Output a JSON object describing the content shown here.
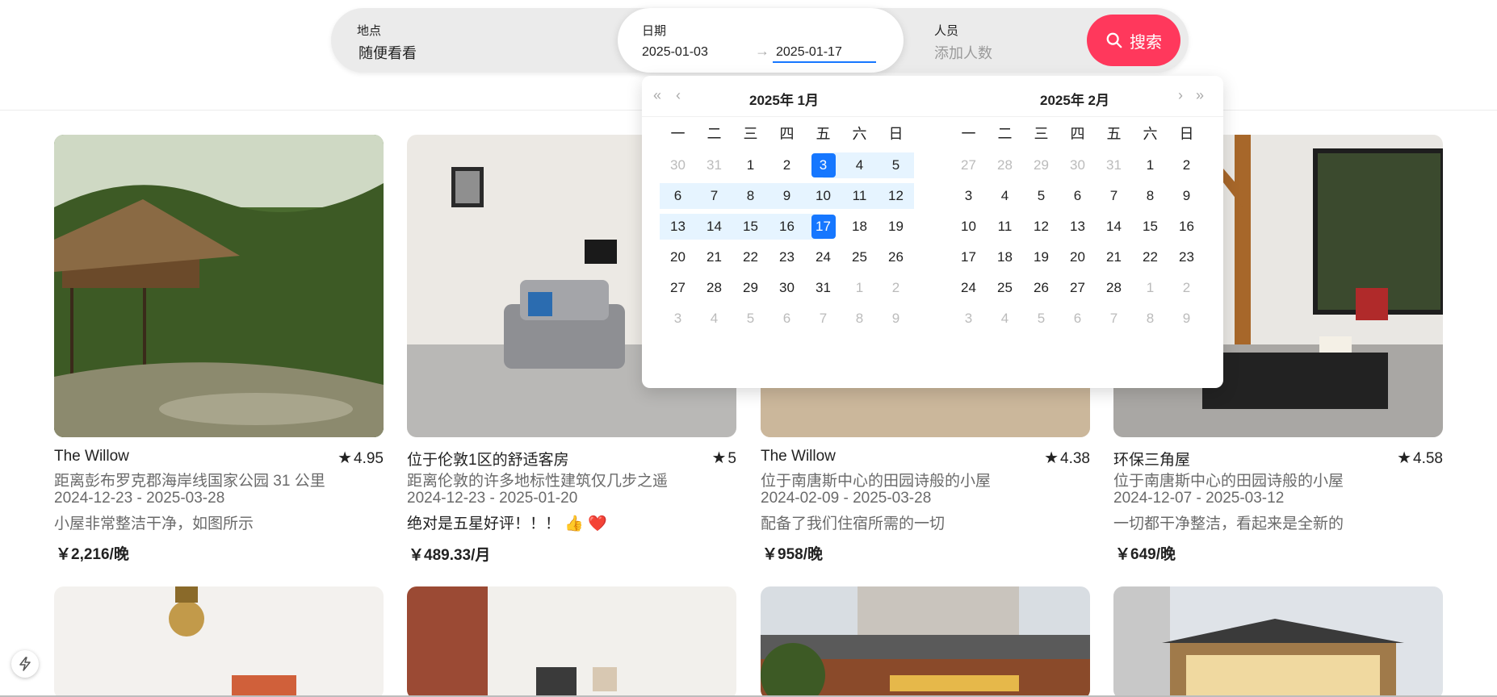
{
  "search": {
    "location_label": "地点",
    "location_value": "随便看看",
    "date_label": "日期",
    "date_start": "2025-01-03",
    "date_end": "2025-01-17",
    "guests_label": "人员",
    "guests_placeholder": "添加人数",
    "search_button": "搜索",
    "accent_color": "#ff385c"
  },
  "calendar": {
    "weekdays": [
      "一",
      "二",
      "三",
      "四",
      "五",
      "六",
      "日"
    ],
    "months": [
      {
        "title": "2025年  1月",
        "weeks": [
          [
            "30",
            "31",
            "1",
            "2",
            "3",
            "4",
            "5"
          ],
          [
            "6",
            "7",
            "8",
            "9",
            "10",
            "11",
            "12"
          ],
          [
            "13",
            "14",
            "15",
            "16",
            "17",
            "18",
            "19"
          ],
          [
            "20",
            "21",
            "22",
            "23",
            "24",
            "25",
            "26"
          ],
          [
            "27",
            "28",
            "29",
            "30",
            "31",
            "1",
            "2"
          ],
          [
            "3",
            "4",
            "5",
            "6",
            "7",
            "8",
            "9"
          ]
        ]
      },
      {
        "title": "2025年  2月",
        "weeks": [
          [
            "27",
            "28",
            "29",
            "30",
            "31",
            "1",
            "2"
          ],
          [
            "3",
            "4",
            "5",
            "6",
            "7",
            "8",
            "9"
          ],
          [
            "10",
            "11",
            "12",
            "13",
            "14",
            "15",
            "16"
          ],
          [
            "17",
            "18",
            "19",
            "20",
            "21",
            "22",
            "23"
          ],
          [
            "24",
            "25",
            "26",
            "27",
            "28",
            "1",
            "2"
          ],
          [
            "3",
            "4",
            "5",
            "6",
            "7",
            "8",
            "9"
          ]
        ]
      }
    ],
    "selected_start": "3",
    "selected_end": "17",
    "selection_color": "#1677ff",
    "range_color": "#e6f4ff"
  },
  "listings": [
    {
      "title": "The Willow",
      "rating": "4.95",
      "distance": "距离彭布罗克郡海岸线国家公园 31 公里",
      "dates": "2024-12-23 - 2025-03-28",
      "review": "小屋非常整洁干净，如图所示",
      "price": "￥2,216/晚"
    },
    {
      "title": "位于伦敦1区的舒适客房",
      "rating": "5",
      "distance": "距离伦敦的许多地标性建筑仅几步之遥",
      "dates": "2024-12-23 - 2025-01-20",
      "review": "绝对是五星好评！！！ 👍 ❤️",
      "price": "￥489.33/月"
    },
    {
      "title": "The Willow",
      "rating": "4.38",
      "distance": "位于南唐斯中心的田园诗般的小屋",
      "dates": "2024-02-09 - 2025-03-28",
      "review": "配备了我们住宿所需的一切",
      "price": "￥958/晚"
    },
    {
      "title": "环保三角屋",
      "rating": "4.58",
      "distance": "位于南唐斯中心的田园诗般的小屋",
      "dates": "2024-12-07 - 2025-03-12",
      "review": "一切都干净整洁，看起来是全新的",
      "price": "￥649/晚"
    }
  ]
}
